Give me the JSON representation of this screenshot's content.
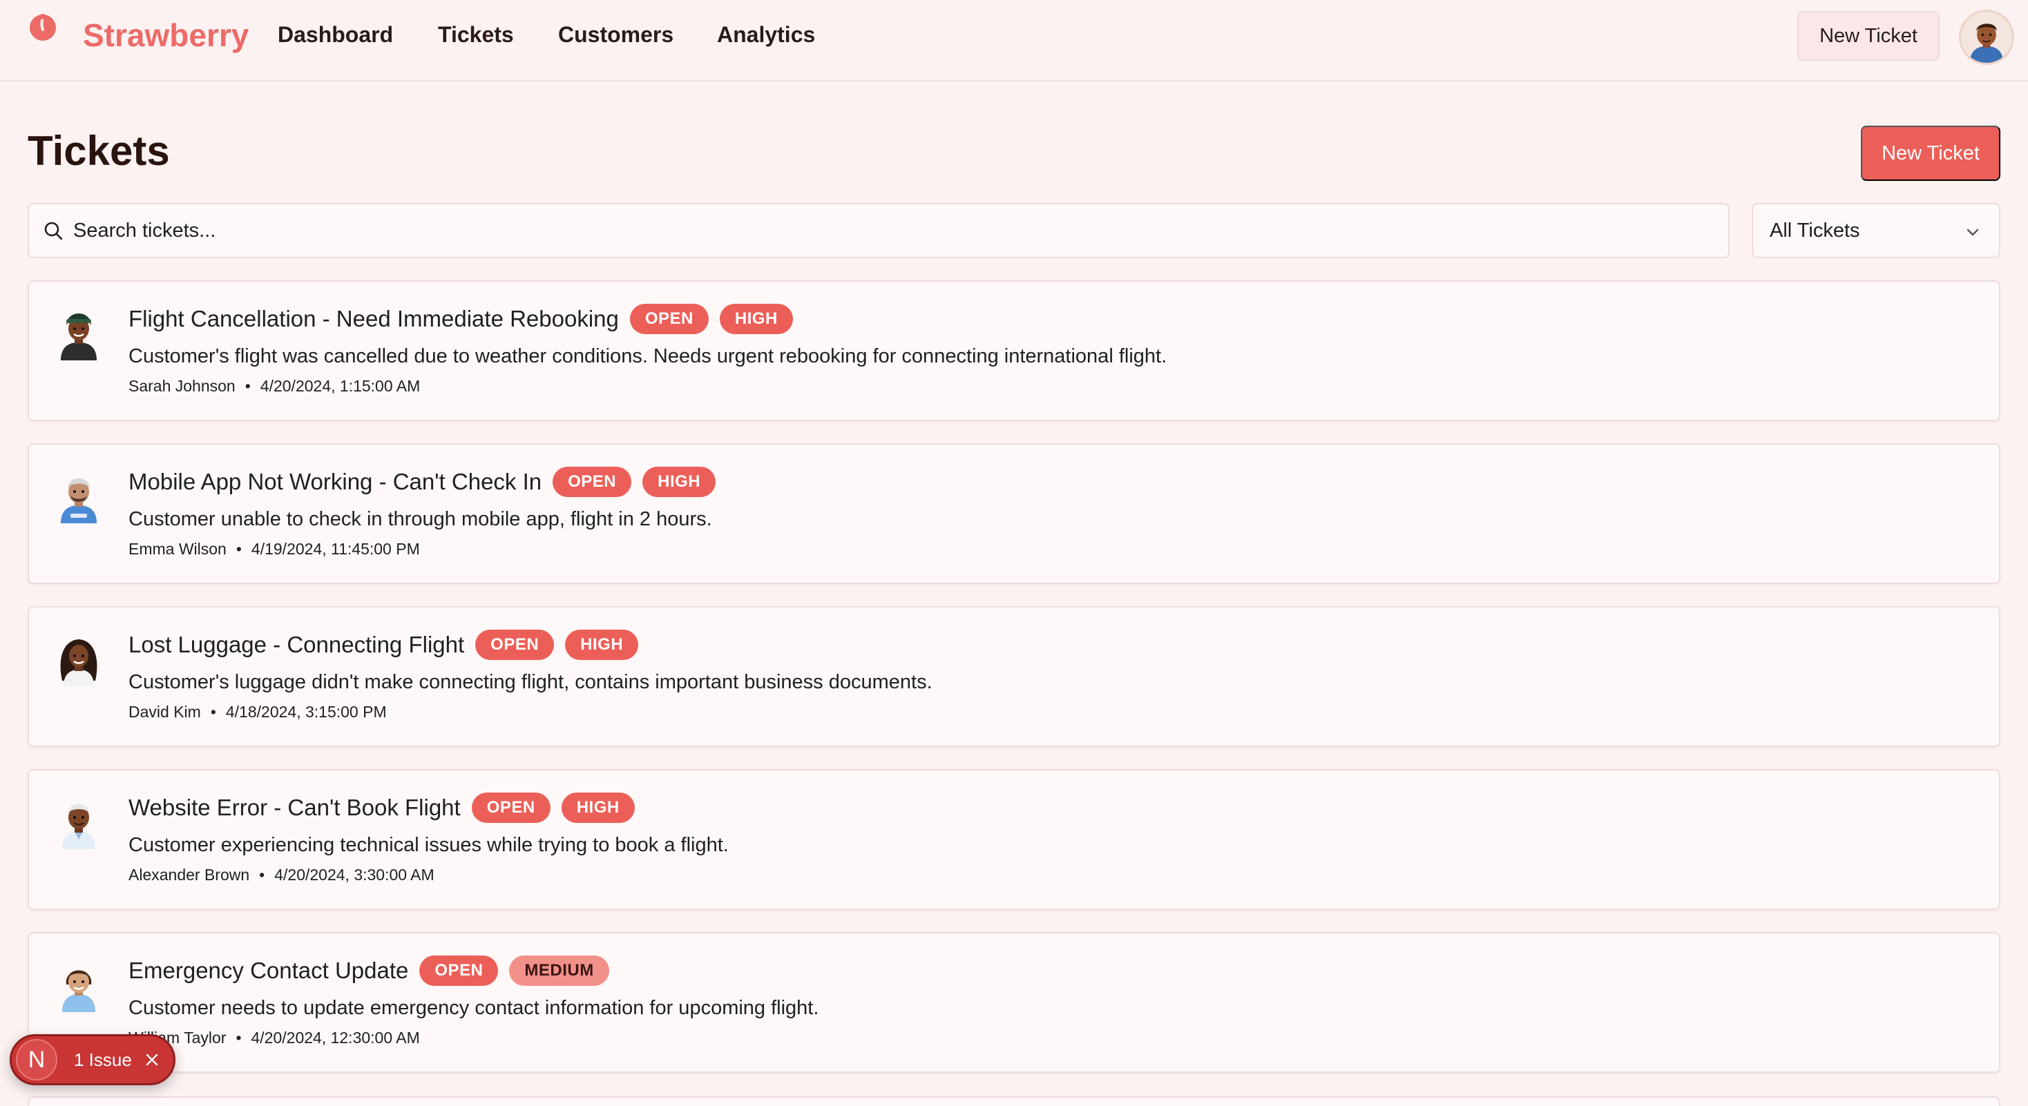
{
  "brand": {
    "name": "Strawberry"
  },
  "nav": {
    "links": [
      "Dashboard",
      "Tickets",
      "Customers",
      "Analytics"
    ],
    "new_ticket_label": "New Ticket"
  },
  "page": {
    "title": "Tickets",
    "new_ticket_label": "New Ticket"
  },
  "search": {
    "placeholder": "Search tickets..."
  },
  "filter": {
    "selected": "All Tickets"
  },
  "tickets": [
    {
      "title": "Flight Cancellation - Need Immediate Rebooking",
      "status": "OPEN",
      "priority": "HIGH",
      "description": "Customer's flight was cancelled due to weather conditions. Needs urgent rebooking for connecting international flight.",
      "customer": "Sarah Johnson",
      "datetime": "4/20/2024, 1:15:00 AM"
    },
    {
      "title": "Mobile App Not Working - Can't Check In",
      "status": "OPEN",
      "priority": "HIGH",
      "description": "Customer unable to check in through mobile app, flight in 2 hours.",
      "customer": "Emma Wilson",
      "datetime": "4/19/2024, 11:45:00 PM"
    },
    {
      "title": "Lost Luggage - Connecting Flight",
      "status": "OPEN",
      "priority": "HIGH",
      "description": "Customer's luggage didn't make connecting flight, contains important business documents.",
      "customer": "David Kim",
      "datetime": "4/18/2024, 3:15:00 PM"
    },
    {
      "title": "Website Error - Can't Book Flight",
      "status": "OPEN",
      "priority": "HIGH",
      "description": "Customer experiencing technical issues while trying to book a flight.",
      "customer": "Alexander Brown",
      "datetime": "4/20/2024, 3:30:00 AM"
    },
    {
      "title": "Emergency Contact Update",
      "status": "OPEN",
      "priority": "MEDIUM",
      "description": "Customer needs to update emergency contact information for upcoming flight.",
      "customer": "William Taylor",
      "datetime": "4/20/2024, 12:30:00 AM"
    }
  ],
  "meta_separator": "•",
  "toast": {
    "letter": "N",
    "label": "1 Issue"
  },
  "colors": {
    "accent": "#ec5f58",
    "brand": "#ec6b67",
    "background": "#fcf2f2"
  }
}
